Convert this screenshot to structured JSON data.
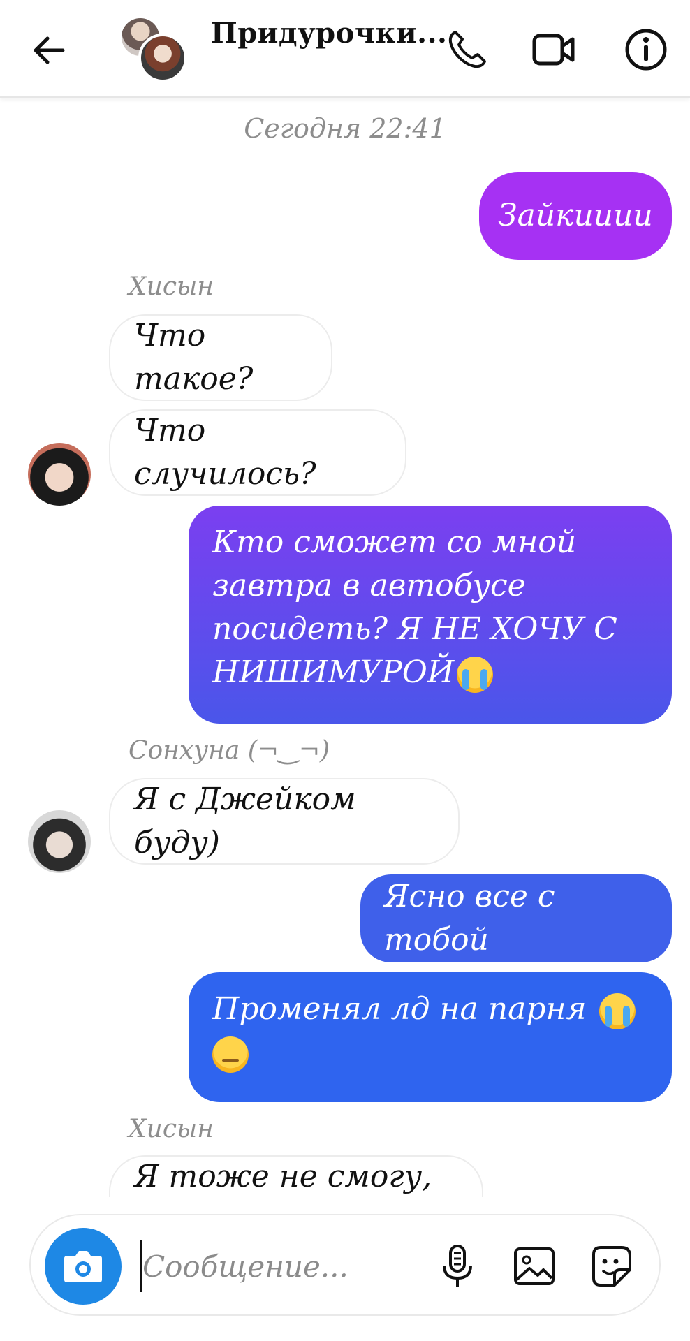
{
  "header": {
    "title": "Придурочки...",
    "icons": [
      "back-arrow-icon",
      "phone-icon",
      "video-icon",
      "info-icon"
    ]
  },
  "chat": {
    "timestamp": "Сегодня 22:41",
    "messages": [
      {
        "side": "out",
        "text": "Зайкииии"
      },
      {
        "side": "in",
        "sender": "Хисын",
        "text": "Что такое?"
      },
      {
        "side": "in",
        "text": "Что случилось?"
      },
      {
        "side": "out",
        "lines": [
          "Кто сможет со мной",
          "завтра в автобусе",
          "посидеть? Я НЕ ХОЧУ С",
          "НИШИМУРОЙ"
        ],
        "emoji": "loudly-crying-face"
      },
      {
        "side": "in",
        "sender": "Сонхуна (¬‿¬)",
        "text": "Я с Джейком буду)"
      },
      {
        "side": "out",
        "text": "Ясно все с тобой"
      },
      {
        "side": "out",
        "lines": [
          "Променял лд на парня",
          ""
        ],
        "emoji": [
          "loudly-crying-face",
          "pensive-face"
        ]
      },
      {
        "side": "in",
        "sender": "Хисын",
        "text": "Я тоже не смогу, я"
      }
    ],
    "colors": {
      "out_bubble_1": "#a631f3",
      "out_bubble_2_top": "#7b3ff0",
      "out_bubble_2_bottom": "#4a56ea",
      "out_bubble_3": "#3f60ea",
      "out_bubble_4": "#2f64ef"
    }
  },
  "composer": {
    "placeholder": "Сообщение...",
    "accent": "#1e88e5"
  }
}
